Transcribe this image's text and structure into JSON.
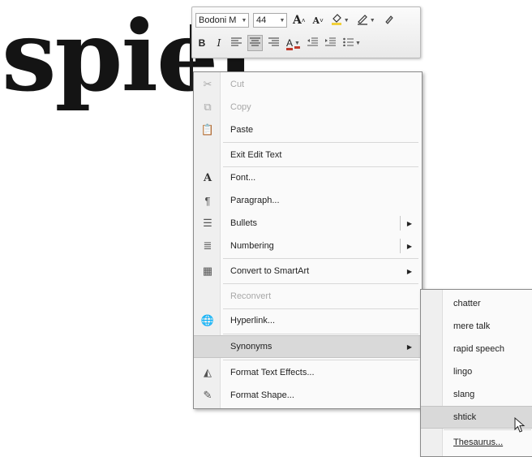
{
  "document": {
    "word": "spiel"
  },
  "minibar": {
    "font_name": "Bodoni M",
    "font_size": "44",
    "grow_font": "A",
    "shrink_font": "A",
    "bold": "B",
    "italic": "I",
    "font_color": "A",
    "highlight_color": "#f1d03a",
    "font_color_value": "#c0392b"
  },
  "context_menu": {
    "items": [
      {
        "label": "Cut",
        "icon": "scissors-icon",
        "disabled": true
      },
      {
        "label": "Copy",
        "icon": "copy-icon",
        "disabled": true
      },
      {
        "label": "Paste",
        "icon": "paste-icon"
      },
      {
        "label": "Exit Edit Text"
      },
      {
        "label": "Font...",
        "icon": "font-icon",
        "glyph": "A"
      },
      {
        "label": "Paragraph...",
        "icon": "paragraph-icon"
      },
      {
        "label": "Bullets",
        "icon": "bullets-icon"
      },
      {
        "label": "Numbering",
        "icon": "numbering-icon"
      },
      {
        "label": "Convert to SmartArt",
        "icon": "smartart-icon"
      },
      {
        "label": "Reconvert",
        "disabled": true
      },
      {
        "label": "Hyperlink...",
        "icon": "hyperlink-icon"
      },
      {
        "label": "Synonyms",
        "highlighted": true
      },
      {
        "label": "Format Text Effects...",
        "icon": "text-effects-icon"
      },
      {
        "label": "Format Shape...",
        "icon": "format-shape-icon"
      }
    ]
  },
  "synonyms_menu": {
    "items": [
      {
        "label": "chatter"
      },
      {
        "label": "mere talk"
      },
      {
        "label": "rapid speech"
      },
      {
        "label": "lingo"
      },
      {
        "label": "slang"
      },
      {
        "label": "shtick",
        "highlighted": true
      },
      {
        "label": "Thesaurus..."
      }
    ]
  }
}
